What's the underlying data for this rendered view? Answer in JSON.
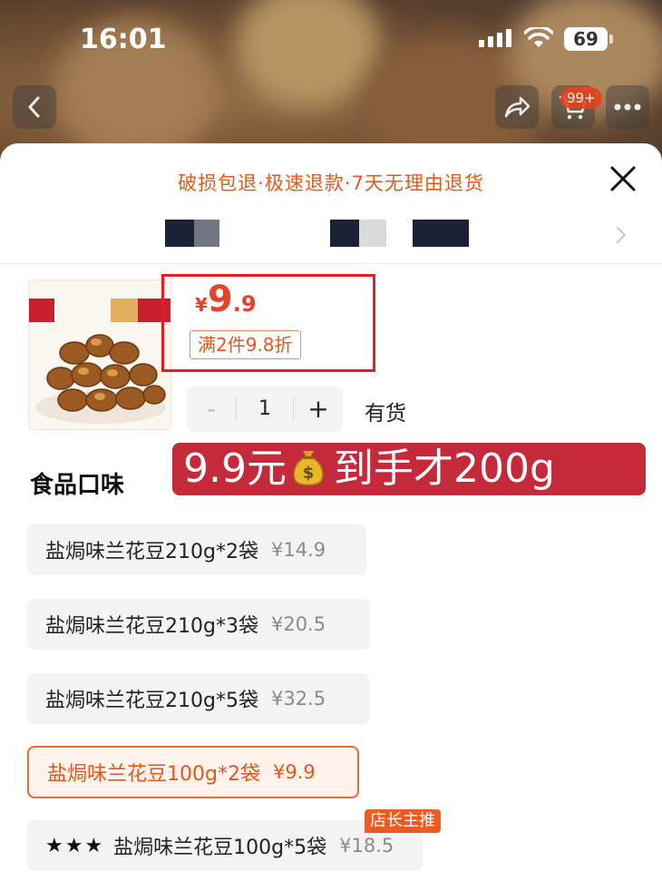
{
  "status_bar": {
    "time": "16:01",
    "battery": "69"
  },
  "header": {
    "cart_badge": "99+"
  },
  "sheet": {
    "service_promise": "破损包退·极速退款·7天无理由退货"
  },
  "product": {
    "price_currency": "¥",
    "price_integer": "9",
    "price_decimal": ".9",
    "discount_tag": "满2件9.8折",
    "quantity": "1",
    "quantity_minus": "-",
    "quantity_plus": "+",
    "stock_status": "有货"
  },
  "overlay_caption": {
    "part1": "9.9元",
    "part2": "到手才200g"
  },
  "options": {
    "title": "食品口味",
    "items": [
      {
        "name": "盐焗味兰花豆210g*2袋",
        "price": "¥14.9"
      },
      {
        "name": "盐焗味兰花豆210g*3袋",
        "price": "¥20.5"
      },
      {
        "name": "盐焗味兰花豆210g*5袋",
        "price": "¥32.5"
      },
      {
        "name": "盐焗味兰花豆100g*2袋",
        "price": "¥9.9"
      },
      {
        "name": "盐焗味兰花豆100g*5袋",
        "price": "¥18.5",
        "prefix": "★★★",
        "badge": "店长主推"
      }
    ]
  },
  "colors": {
    "accent": "#e3571c",
    "highlight_box": "#e02020",
    "caption_bg": "#c42a3a"
  }
}
